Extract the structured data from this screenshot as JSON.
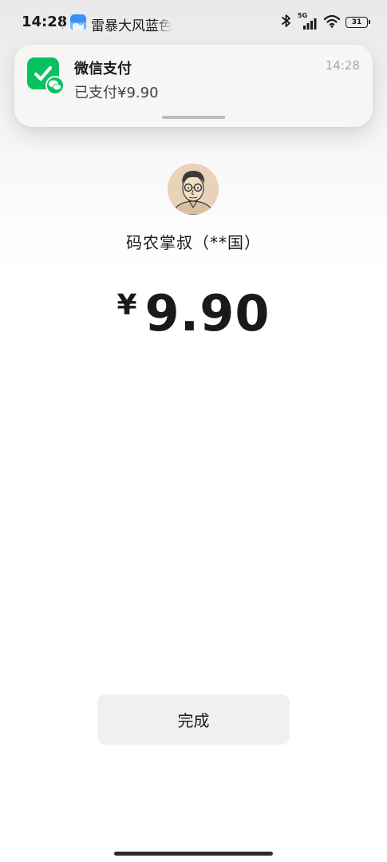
{
  "status_bar": {
    "time": "14:28",
    "app_name": "雷暴大风蓝色预警",
    "network_label": "5G",
    "battery_level": "31",
    "icons": [
      "bluetooth-icon",
      "signal-icon",
      "wifi-icon",
      "battery-icon"
    ]
  },
  "notification": {
    "title": "微信支付",
    "body": "已支付¥9.90",
    "time": "14:28",
    "icon": "wechat-pay-icon",
    "accent_color": "#07c160"
  },
  "payment": {
    "payee": "码农掌叔（**国）",
    "currency_symbol": "¥",
    "amount": "9.90",
    "avatar": "payee-avatar"
  },
  "actions": {
    "done_label": "完成"
  }
}
